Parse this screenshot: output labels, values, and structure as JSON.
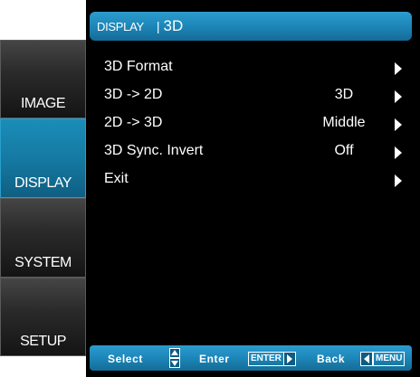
{
  "sidebar": {
    "tabs": [
      {
        "label": "IMAGE",
        "active": false
      },
      {
        "label": "DISPLAY",
        "active": true
      },
      {
        "label": "SYSTEM",
        "active": false
      },
      {
        "label": "SETUP",
        "active": false
      }
    ]
  },
  "header": {
    "title": "DISPLAY",
    "separator": "|",
    "subtitle": "3D"
  },
  "menu": {
    "items": [
      {
        "label": "3D Format",
        "value": ""
      },
      {
        "label": "3D -> 2D",
        "value": "3D"
      },
      {
        "label": "2D -> 3D",
        "value": "Middle"
      },
      {
        "label": "3D Sync. Invert",
        "value": "Off"
      },
      {
        "label": "Exit",
        "value": ""
      }
    ]
  },
  "footer": {
    "select_label": "Select",
    "enter_label": "Enter",
    "enter_key": "ENTER",
    "back_label": "Back",
    "menu_key": "MENU"
  },
  "colors": {
    "accent": "#1d86b8",
    "panel_bg": "#000000",
    "text": "#ffffff"
  }
}
